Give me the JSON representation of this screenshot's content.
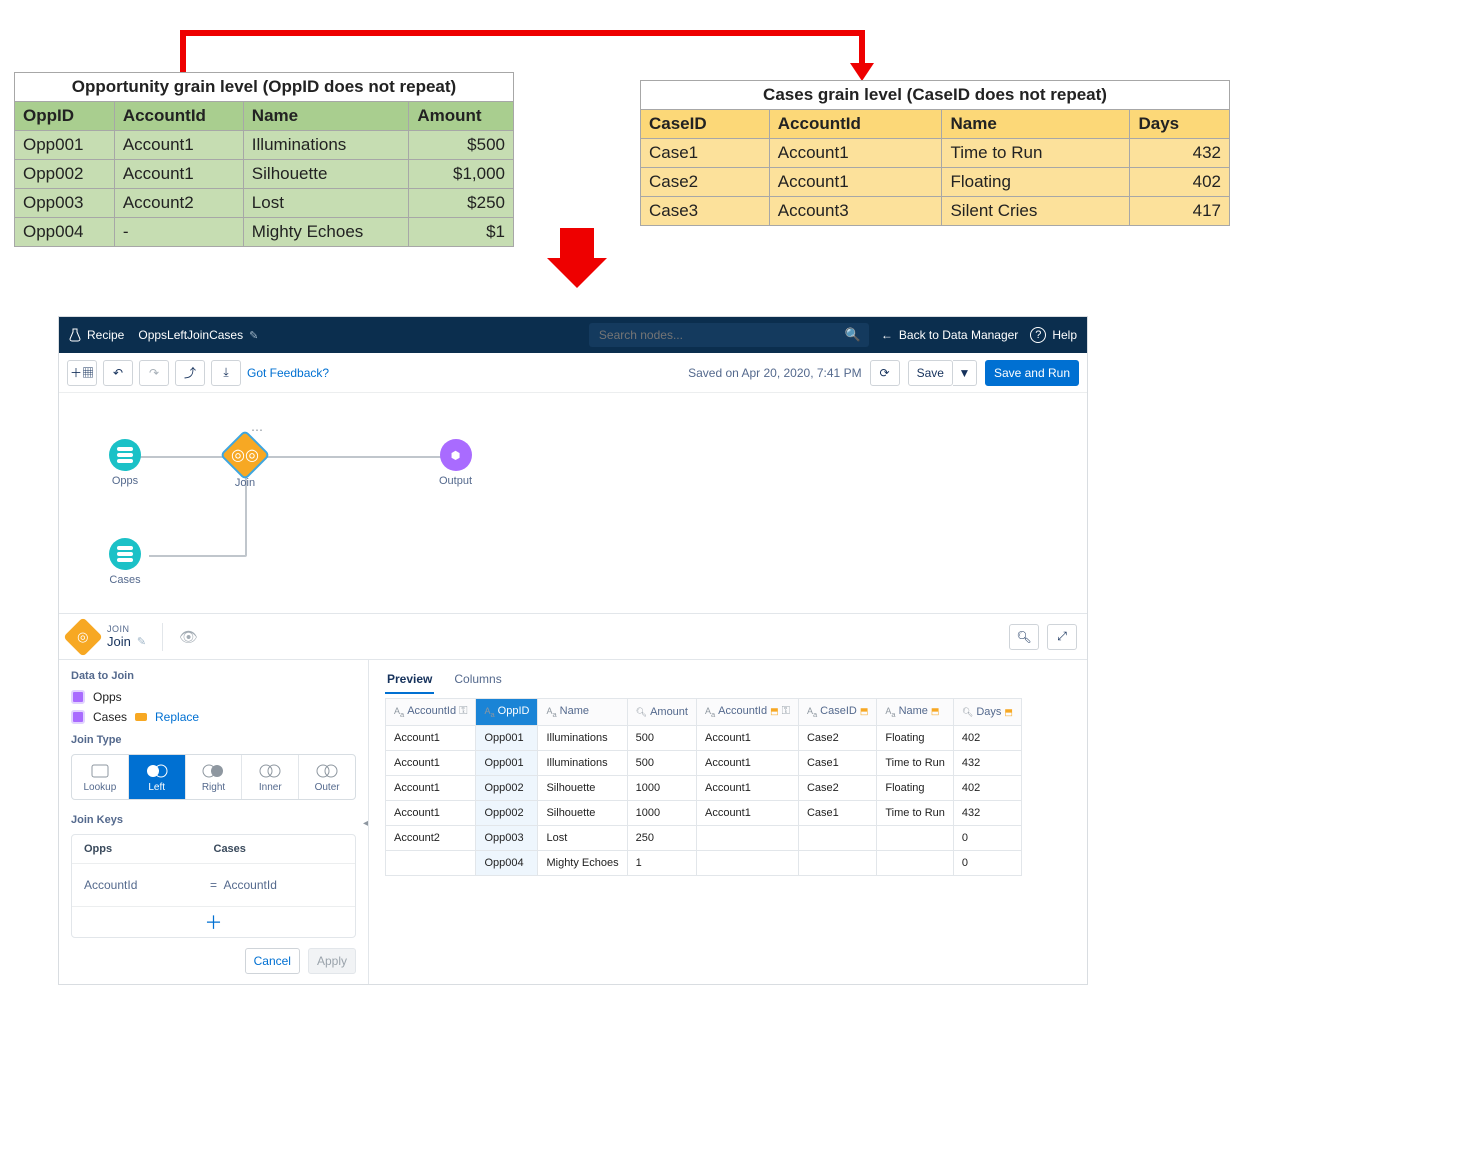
{
  "oppTable": {
    "title": "Opportunity grain level (OppID does not repeat)",
    "headers": [
      "OppID",
      "AccountId",
      "Name",
      "Amount"
    ],
    "rows": [
      [
        "Opp001",
        "Account1",
        "Illuminations",
        "$500"
      ],
      [
        "Opp002",
        "Account1",
        "Silhouette",
        "$1,000"
      ],
      [
        "Opp003",
        "Account2",
        "Lost",
        "$250"
      ],
      [
        "Opp004",
        "-",
        "Mighty Echoes",
        "$1"
      ]
    ]
  },
  "caseTable": {
    "title": "Cases grain level (CaseID does not repeat)",
    "headers": [
      "CaseID",
      "AccountId",
      "Name",
      "Days"
    ],
    "rows": [
      [
        "Case1",
        "Account1",
        "Time to Run",
        "432"
      ],
      [
        "Case2",
        "Account1",
        "Floating",
        "402"
      ],
      [
        "Case3",
        "Account3",
        "Silent Cries",
        "417"
      ]
    ]
  },
  "topbar": {
    "recipe": "Recipe",
    "name": "OppsLeftJoinCases",
    "searchPlaceholder": "Search nodes...",
    "back": "Back to Data Manager",
    "help": "Help"
  },
  "toolbar": {
    "feedback": "Got Feedback?",
    "saved": "Saved on Apr 20, 2020, 7:41 PM",
    "save": "Save",
    "saveRun": "Save and Run"
  },
  "canvas": {
    "opps": "Opps",
    "cases": "Cases",
    "join": "Join",
    "output": "Output"
  },
  "joinbar": {
    "label": "JOIN",
    "name": "Join"
  },
  "side": {
    "dataToJoin": "Data to Join",
    "src1": "Opps",
    "src2": "Cases",
    "replace": "Replace",
    "joinType": "Join Type",
    "types": [
      "Lookup",
      "Left",
      "Right",
      "Inner",
      "Outer"
    ],
    "joinKeys": "Join Keys",
    "kh1": "Opps",
    "kh2": "Cases",
    "k1": "AccountId",
    "k2": "AccountId",
    "cancel": "Cancel",
    "apply": "Apply"
  },
  "preview": {
    "tab1": "Preview",
    "tab2": "Columns",
    "headers": [
      "AccountId",
      "OppID",
      "Name",
      "Amount",
      "AccountId",
      "CaseID",
      "Name",
      "Days"
    ],
    "types": [
      "Aa",
      "Aa",
      "Aa",
      "Q",
      "Aa",
      "Aa",
      "Aa",
      "Q"
    ],
    "keyFlags": [
      true,
      false,
      false,
      false,
      true,
      false,
      false,
      false
    ],
    "linkFlags": [
      false,
      false,
      false,
      false,
      true,
      true,
      true,
      true
    ],
    "rows": [
      [
        "Account1",
        "Opp001",
        "Illuminations",
        "500",
        "Account1",
        "Case2",
        "Floating",
        "402"
      ],
      [
        "Account1",
        "Opp001",
        "Illuminations",
        "500",
        "Account1",
        "Case1",
        "Time to Run",
        "432"
      ],
      [
        "Account1",
        "Opp002",
        "Silhouette",
        "1000",
        "Account1",
        "Case2",
        "Floating",
        "402"
      ],
      [
        "Account1",
        "Opp002",
        "Silhouette",
        "1000",
        "Account1",
        "Case1",
        "Time to Run",
        "432"
      ],
      [
        "Account2",
        "Opp003",
        "Lost",
        "250",
        "",
        "",
        "",
        "0"
      ],
      [
        "",
        "Opp004",
        "Mighty Echoes",
        "1",
        "",
        "",
        "",
        "0"
      ]
    ]
  }
}
